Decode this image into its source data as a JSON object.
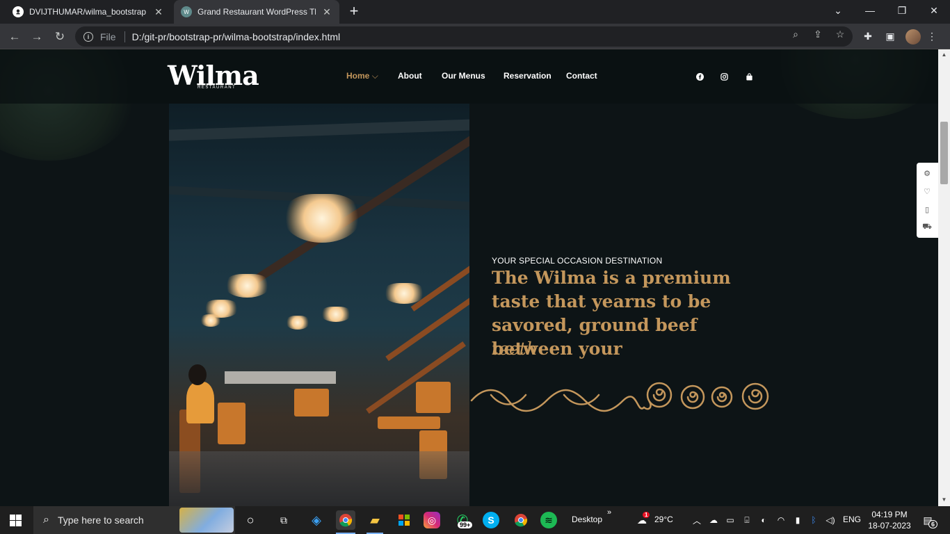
{
  "browser": {
    "tabs": [
      {
        "title": "DVIJTHUMAR/wilma_bootstrap",
        "favicon": "github-icon"
      },
      {
        "title": "Grand Restaurant WordPress The",
        "favicon": "site-icon"
      }
    ],
    "address": {
      "scheme_label": "File",
      "url": "D:/git-pr/bootstrap-pr/wilma-bootstrap/index.html"
    }
  },
  "site": {
    "logo": "Wilma",
    "logo_sub": "RESTAURANT",
    "nav": [
      {
        "label": "Home",
        "active": true,
        "dropdown": true
      },
      {
        "label": "About"
      },
      {
        "label": "Our Menus"
      },
      {
        "label": "Reservation"
      },
      {
        "label": "Contact"
      }
    ],
    "social_icons": [
      "facebook-icon",
      "instagram-icon",
      "shopping-bag-icon"
    ],
    "hero": {
      "eyebrow": "YOUR SPECIAL OCCASION DESTINATION",
      "headline": "The Wilma is a premium taste that yearns to be savored, ground beef between your",
      "headline_italic": "teeth",
      "accent_color": "#c4975c"
    },
    "side_tools": [
      "gear-icon",
      "heart-icon",
      "book-icon",
      "cart-icon"
    ]
  },
  "taskbar": {
    "search_placeholder": "Type here to search",
    "whatsapp_badge": "99+",
    "desktop_label": "Desktop",
    "weather": {
      "temp": "29°C",
      "badge": "1"
    },
    "language": "ENG",
    "time": "04:19 PM",
    "date": "18-07-2023",
    "notification_count": "6"
  }
}
